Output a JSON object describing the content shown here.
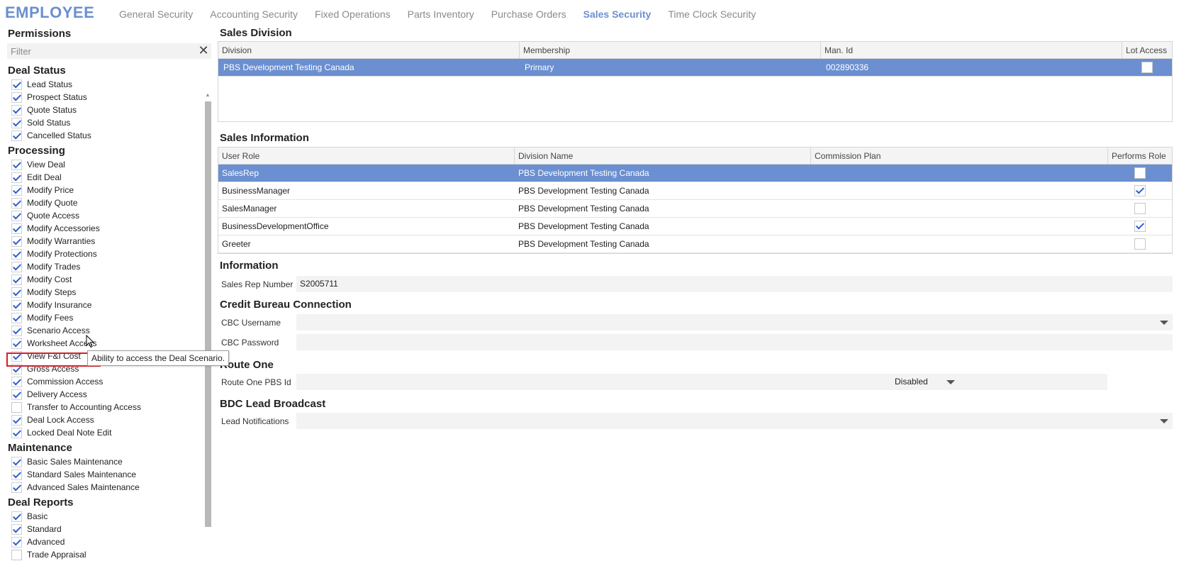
{
  "app_title": "EMPLOYEE",
  "tabs": [
    {
      "label": "General Security",
      "active": false
    },
    {
      "label": "Accounting Security",
      "active": false
    },
    {
      "label": "Fixed Operations",
      "active": false
    },
    {
      "label": "Parts Inventory",
      "active": false
    },
    {
      "label": "Purchase Orders",
      "active": false
    },
    {
      "label": "Sales Security",
      "active": true
    },
    {
      "label": "Time Clock Security",
      "active": false
    }
  ],
  "permissions": {
    "title": "Permissions",
    "filter_placeholder": "Filter",
    "clear_icon": "close-icon",
    "groups": [
      {
        "name": "Deal Status",
        "items": [
          {
            "label": "Lead Status",
            "checked": true
          },
          {
            "label": "Prospect Status",
            "checked": true
          },
          {
            "label": "Quote Status",
            "checked": true
          },
          {
            "label": "Sold Status",
            "checked": true
          },
          {
            "label": "Cancelled Status",
            "checked": true
          }
        ]
      },
      {
        "name": "Processing",
        "items": [
          {
            "label": "View Deal",
            "checked": true
          },
          {
            "label": "Edit Deal",
            "checked": true
          },
          {
            "label": "Modify Price",
            "checked": true
          },
          {
            "label": "Modify Quote",
            "checked": true
          },
          {
            "label": "Quote Access",
            "checked": true
          },
          {
            "label": "Modify Accessories",
            "checked": true
          },
          {
            "label": "Modify Warranties",
            "checked": true
          },
          {
            "label": "Modify Protections",
            "checked": true
          },
          {
            "label": "Modify Trades",
            "checked": true
          },
          {
            "label": "Modify Cost",
            "checked": true
          },
          {
            "label": "Modify Steps",
            "checked": true
          },
          {
            "label": "Modify Insurance",
            "checked": true
          },
          {
            "label": "Modify Fees",
            "checked": true
          },
          {
            "label": "Scenario Access",
            "checked": true
          },
          {
            "label": "Worksheet Access",
            "checked": true
          },
          {
            "label": "View F&I Cost",
            "checked": true
          },
          {
            "label": "Gross Access",
            "checked": true
          },
          {
            "label": "Commission Access",
            "checked": true
          },
          {
            "label": "Delivery Access",
            "checked": true
          },
          {
            "label": "Transfer to Accounting Access",
            "checked": false
          },
          {
            "label": "Deal Lock Access",
            "checked": true
          },
          {
            "label": "Locked Deal Note Edit",
            "checked": true
          }
        ]
      },
      {
        "name": "Maintenance",
        "items": [
          {
            "label": "Basic Sales Maintenance",
            "checked": true
          },
          {
            "label": "Standard Sales Maintenance",
            "checked": true
          },
          {
            "label": "Advanced Sales Maintenance",
            "checked": true
          }
        ]
      },
      {
        "name": "Deal Reports",
        "items": [
          {
            "label": "Basic",
            "checked": true
          },
          {
            "label": "Standard",
            "checked": true
          },
          {
            "label": "Advanced",
            "checked": true
          },
          {
            "label": "Trade Appraisal",
            "checked": false
          }
        ]
      }
    ],
    "tooltip": "Ability to access the Deal Scenario."
  },
  "sales_division": {
    "title": "Sales Division",
    "columns": [
      "Division",
      "Membership",
      "Man. Id",
      "Lot Access"
    ],
    "rows": [
      {
        "division": "PBS Development Testing Canada",
        "membership": "Primary",
        "man_id": "002890336",
        "lot_access": false,
        "selected": true
      }
    ]
  },
  "sales_information": {
    "title": "Sales Information",
    "columns": [
      "User Role",
      "Division Name",
      "Commission Plan",
      "Performs Role"
    ],
    "rows": [
      {
        "role": "SalesRep",
        "division": "PBS Development Testing Canada",
        "plan": "",
        "performs": false,
        "selected": true
      },
      {
        "role": "BusinessManager",
        "division": "PBS Development Testing Canada",
        "plan": "",
        "performs": true,
        "selected": false
      },
      {
        "role": "SalesManager",
        "division": "PBS Development Testing Canada",
        "plan": "",
        "performs": false,
        "selected": false
      },
      {
        "role": "BusinessDevelopmentOffice",
        "division": "PBS Development Testing Canada",
        "plan": "",
        "performs": true,
        "selected": false
      },
      {
        "role": "Greeter",
        "division": "PBS Development Testing Canada",
        "plan": "",
        "performs": false,
        "selected": false
      }
    ]
  },
  "information": {
    "title": "Information",
    "sales_rep_label": "Sales Rep Number",
    "sales_rep_value": "S2005711"
  },
  "credit_bureau": {
    "title": "Credit Bureau Connection",
    "username_label": "CBC Username",
    "username_value": "",
    "password_label": "CBC Password",
    "password_value": ""
  },
  "route_one": {
    "title": "Route One",
    "id_label": "Route One PBS Id",
    "id_value": "",
    "status_value": "Disabled"
  },
  "bdc": {
    "title": "BDC Lead Broadcast",
    "notifications_label": "Lead Notifications",
    "notifications_value": ""
  },
  "colors": {
    "accent": "#6b8fd0",
    "highlight": "#d3212d",
    "check": "#2d5fcf"
  }
}
